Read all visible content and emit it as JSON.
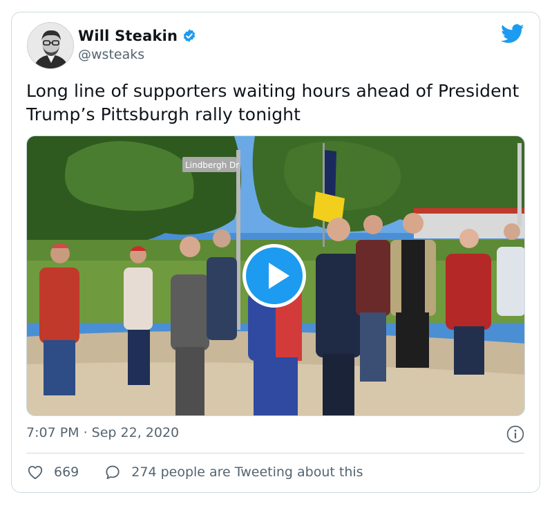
{
  "tweet": {
    "author_name": "Will Steakin",
    "handle": "@wsteaks",
    "text": "Long line of supporters waiting hours ahead of President Trump’s Pittsburgh rally tonight",
    "timestamp": "7:07 PM · Sep 22, 2020",
    "likes": "669",
    "retweets_label": "274 people are Tweeting about this",
    "street_sign": "Lindbergh Dr"
  },
  "icons": {
    "verified": "verified-badge-icon",
    "logo": "twitter-bird-icon",
    "play": "play-icon",
    "info": "info-icon",
    "like": "heart-icon",
    "reply": "speech-bubble-icon"
  },
  "colors": {
    "accent": "#1d9bf0",
    "text_primary": "#0f1419",
    "text_secondary": "#536471",
    "border": "#cfd9de"
  }
}
